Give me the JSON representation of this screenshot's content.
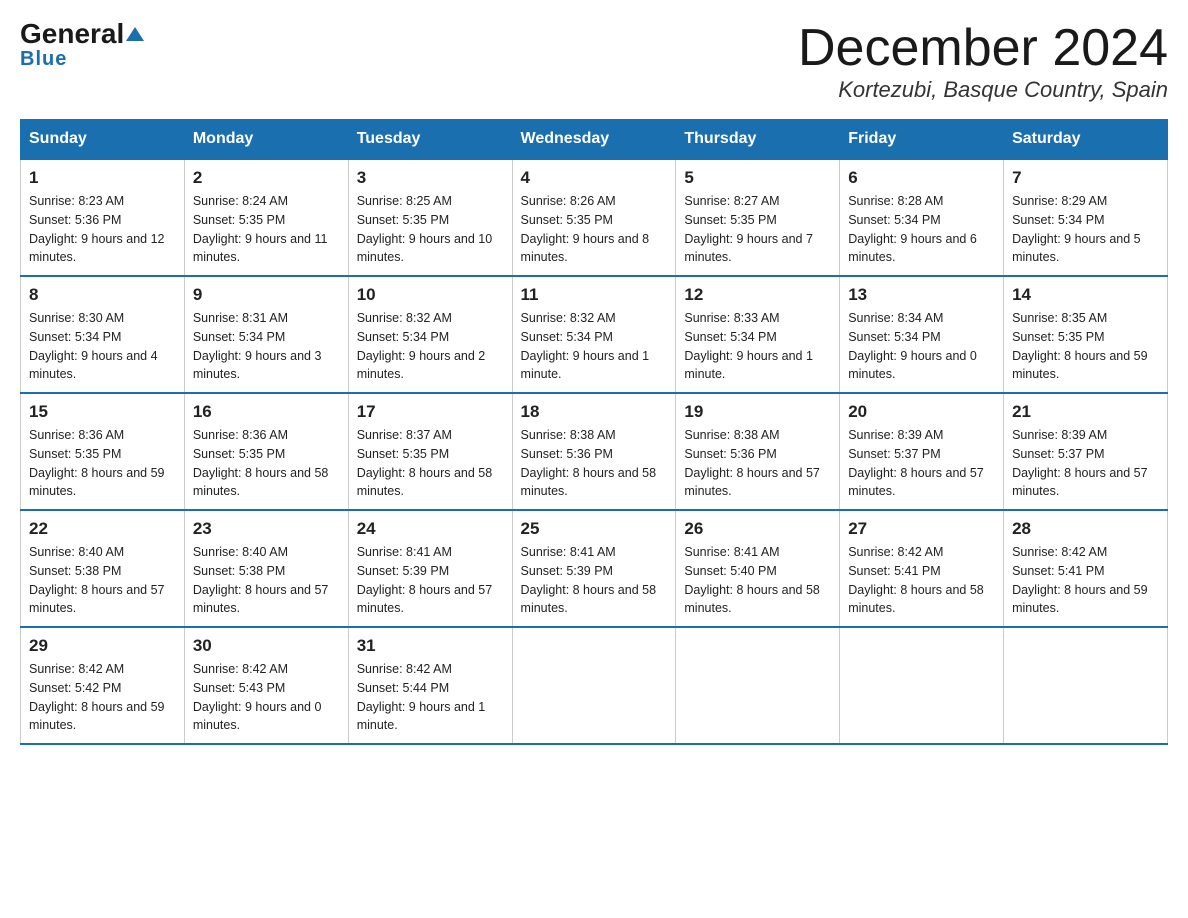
{
  "logo": {
    "general": "General",
    "blue": "Blue"
  },
  "title": {
    "month": "December 2024",
    "location": "Kortezubi, Basque Country, Spain"
  },
  "days": [
    "Sunday",
    "Monday",
    "Tuesday",
    "Wednesday",
    "Thursday",
    "Friday",
    "Saturday"
  ],
  "weeks": [
    [
      {
        "num": "1",
        "sunrise": "8:23 AM",
        "sunset": "5:36 PM",
        "daylight": "9 hours and 12 minutes."
      },
      {
        "num": "2",
        "sunrise": "8:24 AM",
        "sunset": "5:35 PM",
        "daylight": "9 hours and 11 minutes."
      },
      {
        "num": "3",
        "sunrise": "8:25 AM",
        "sunset": "5:35 PM",
        "daylight": "9 hours and 10 minutes."
      },
      {
        "num": "4",
        "sunrise": "8:26 AM",
        "sunset": "5:35 PM",
        "daylight": "9 hours and 8 minutes."
      },
      {
        "num": "5",
        "sunrise": "8:27 AM",
        "sunset": "5:35 PM",
        "daylight": "9 hours and 7 minutes."
      },
      {
        "num": "6",
        "sunrise": "8:28 AM",
        "sunset": "5:34 PM",
        "daylight": "9 hours and 6 minutes."
      },
      {
        "num": "7",
        "sunrise": "8:29 AM",
        "sunset": "5:34 PM",
        "daylight": "9 hours and 5 minutes."
      }
    ],
    [
      {
        "num": "8",
        "sunrise": "8:30 AM",
        "sunset": "5:34 PM",
        "daylight": "9 hours and 4 minutes."
      },
      {
        "num": "9",
        "sunrise": "8:31 AM",
        "sunset": "5:34 PM",
        "daylight": "9 hours and 3 minutes."
      },
      {
        "num": "10",
        "sunrise": "8:32 AM",
        "sunset": "5:34 PM",
        "daylight": "9 hours and 2 minutes."
      },
      {
        "num": "11",
        "sunrise": "8:32 AM",
        "sunset": "5:34 PM",
        "daylight": "9 hours and 1 minute."
      },
      {
        "num": "12",
        "sunrise": "8:33 AM",
        "sunset": "5:34 PM",
        "daylight": "9 hours and 1 minute."
      },
      {
        "num": "13",
        "sunrise": "8:34 AM",
        "sunset": "5:34 PM",
        "daylight": "9 hours and 0 minutes."
      },
      {
        "num": "14",
        "sunrise": "8:35 AM",
        "sunset": "5:35 PM",
        "daylight": "8 hours and 59 minutes."
      }
    ],
    [
      {
        "num": "15",
        "sunrise": "8:36 AM",
        "sunset": "5:35 PM",
        "daylight": "8 hours and 59 minutes."
      },
      {
        "num": "16",
        "sunrise": "8:36 AM",
        "sunset": "5:35 PM",
        "daylight": "8 hours and 58 minutes."
      },
      {
        "num": "17",
        "sunrise": "8:37 AM",
        "sunset": "5:35 PM",
        "daylight": "8 hours and 58 minutes."
      },
      {
        "num": "18",
        "sunrise": "8:38 AM",
        "sunset": "5:36 PM",
        "daylight": "8 hours and 58 minutes."
      },
      {
        "num": "19",
        "sunrise": "8:38 AM",
        "sunset": "5:36 PM",
        "daylight": "8 hours and 57 minutes."
      },
      {
        "num": "20",
        "sunrise": "8:39 AM",
        "sunset": "5:37 PM",
        "daylight": "8 hours and 57 minutes."
      },
      {
        "num": "21",
        "sunrise": "8:39 AM",
        "sunset": "5:37 PM",
        "daylight": "8 hours and 57 minutes."
      }
    ],
    [
      {
        "num": "22",
        "sunrise": "8:40 AM",
        "sunset": "5:38 PM",
        "daylight": "8 hours and 57 minutes."
      },
      {
        "num": "23",
        "sunrise": "8:40 AM",
        "sunset": "5:38 PM",
        "daylight": "8 hours and 57 minutes."
      },
      {
        "num": "24",
        "sunrise": "8:41 AM",
        "sunset": "5:39 PM",
        "daylight": "8 hours and 57 minutes."
      },
      {
        "num": "25",
        "sunrise": "8:41 AM",
        "sunset": "5:39 PM",
        "daylight": "8 hours and 58 minutes."
      },
      {
        "num": "26",
        "sunrise": "8:41 AM",
        "sunset": "5:40 PM",
        "daylight": "8 hours and 58 minutes."
      },
      {
        "num": "27",
        "sunrise": "8:42 AM",
        "sunset": "5:41 PM",
        "daylight": "8 hours and 58 minutes."
      },
      {
        "num": "28",
        "sunrise": "8:42 AM",
        "sunset": "5:41 PM",
        "daylight": "8 hours and 59 minutes."
      }
    ],
    [
      {
        "num": "29",
        "sunrise": "8:42 AM",
        "sunset": "5:42 PM",
        "daylight": "8 hours and 59 minutes."
      },
      {
        "num": "30",
        "sunrise": "8:42 AM",
        "sunset": "5:43 PM",
        "daylight": "9 hours and 0 minutes."
      },
      {
        "num": "31",
        "sunrise": "8:42 AM",
        "sunset": "5:44 PM",
        "daylight": "9 hours and 1 minute."
      },
      null,
      null,
      null,
      null
    ]
  ]
}
